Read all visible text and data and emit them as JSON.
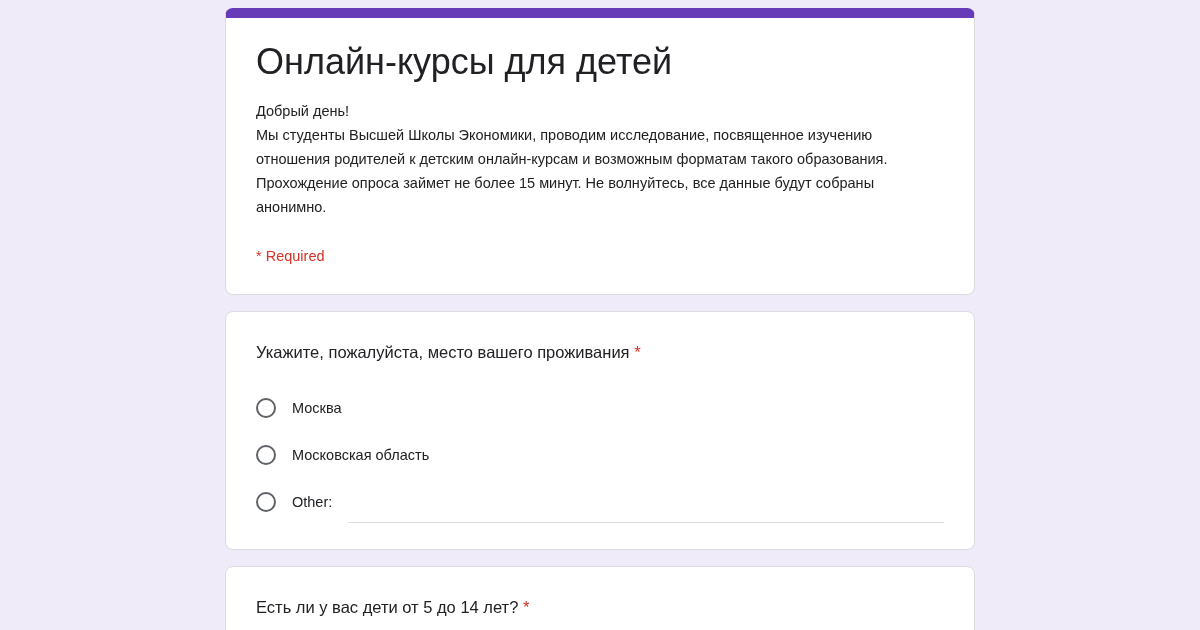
{
  "header": {
    "title": "Онлайн-курсы для детей",
    "greeting": "Добрый день!",
    "description": "Мы студенты Высшей Школы Экономики, проводим исследование, посвященное изучению отношения родителей к детским онлайн-курсам и возможным форматам такого образования. Прохождение опроса займет не более 15 минут. Не волнуйтесь, все данные будут собраны анонимно.",
    "required_note": "* Required"
  },
  "questions": [
    {
      "title": "Укажите, пожалуйста, место вашего проживания",
      "required_mark": "*",
      "options": [
        {
          "kind": "radio",
          "label": "Москва",
          "selected": false
        },
        {
          "kind": "radio",
          "label": "Московская область",
          "selected": false
        },
        {
          "kind": "other",
          "label": "Other:",
          "selected": false
        }
      ]
    },
    {
      "title": "Есть ли у вас дети от 5 до 14 лет?",
      "required_mark": "*"
    }
  ]
}
